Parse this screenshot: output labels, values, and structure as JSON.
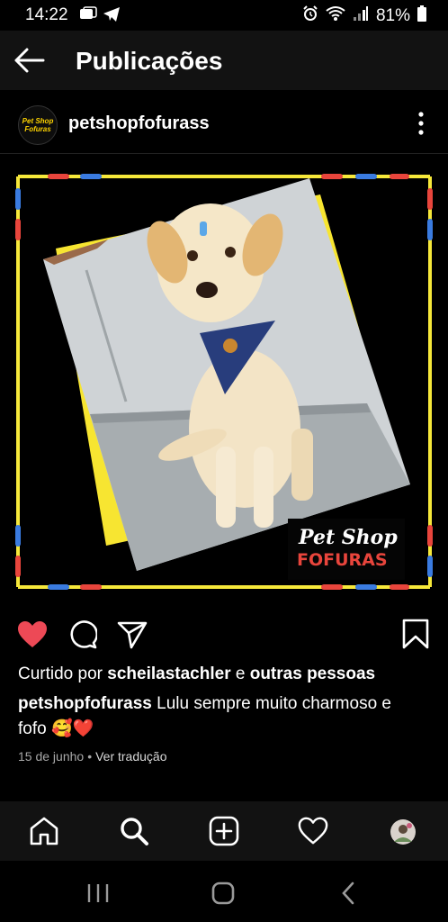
{
  "status": {
    "time": "14:22",
    "battery": "81%"
  },
  "appbar": {
    "title": "Publicações"
  },
  "post": {
    "username": "petshopfofurass",
    "avatar_text": "Pet Shop Fofuras",
    "image_logo_line1": "Pet Shop",
    "image_logo_line2": "FOFURAS",
    "likes_prefix": "Curtido por ",
    "likes_user": "scheilastachler",
    "likes_middle": " e ",
    "likes_others": "outras pessoas",
    "caption_user": "petshopfofurass",
    "caption_text": " Lulu sempre muito charmoso e fofo 🥰❤️",
    "date": "15 de junho",
    "separator": "•",
    "translate": "Ver tradução",
    "liked": true
  },
  "colors": {
    "like": "#ed4956",
    "frame_yellow": "#f6e83a",
    "frame_blue": "#3a7be0",
    "frame_red": "#e8453c"
  },
  "icons": [
    "back-arrow-icon",
    "more-icon",
    "heart-icon",
    "comment-icon",
    "share-icon",
    "bookmark-icon",
    "home-icon",
    "search-icon",
    "create-icon",
    "activity-icon",
    "profile-icon"
  ]
}
